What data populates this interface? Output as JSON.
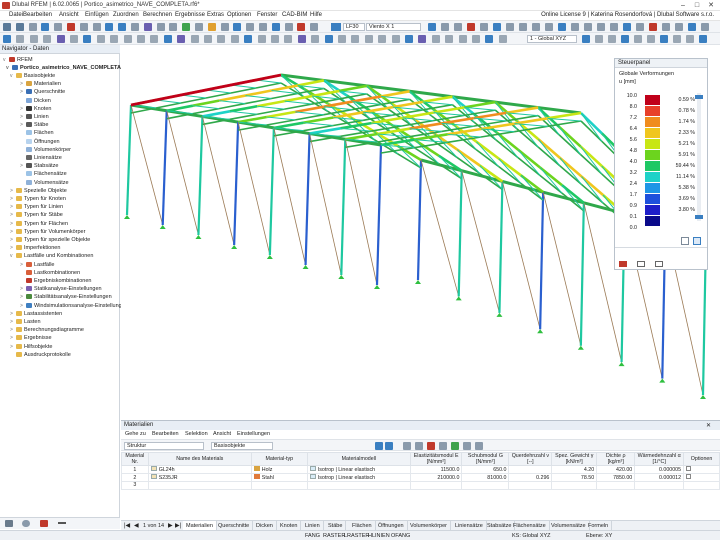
{
  "titlebar": {
    "title": "Dlubal RFEM | 6.02.0065 | Portico_asimetrico_NAVE_COMPLETA.rf6*"
  },
  "menu": {
    "items": [
      "Datei",
      "Bearbeiten",
      "Ansicht",
      "Einfügen",
      "Zuordnen",
      "Berechnen",
      "Ergebnisse",
      "Extras",
      "Optionen",
      "Fenster",
      "CAD-BIM",
      "Hilfe"
    ],
    "license": "Online License 9 | Katerina Rosendorfová | Dlubal Software s.r.o."
  },
  "toolbar": {
    "load_case": "LF30",
    "load_name": "Viento X 1",
    "coord_system": "1 - Global XYZ"
  },
  "navigator": {
    "title": "Navigator - Daten",
    "root": "RFEM",
    "project": "Portico_asimetrico_NAVE_COMPLETA.rf6*",
    "items": [
      {
        "label": "Basisobjekte",
        "level": 1,
        "exp": "v",
        "icon": "#e6b94a"
      },
      {
        "label": "Materialien",
        "level": 2,
        "exp": ">",
        "icon": "#d9a441"
      },
      {
        "label": "Querschnitte",
        "level": 2,
        "exp": ">",
        "icon": "#3a6fb5"
      },
      {
        "label": "Dicken",
        "level": 2,
        "exp": "",
        "icon": "#7ea6d8"
      },
      {
        "label": "Knoten",
        "level": 2,
        "exp": ">",
        "icon": "#333333"
      },
      {
        "label": "Linien",
        "level": 2,
        "exp": ">",
        "icon": "#555555"
      },
      {
        "label": "Stäbe",
        "level": 2,
        "exp": ">",
        "icon": "#5a5a5a"
      },
      {
        "label": "Flächen",
        "level": 2,
        "exp": "",
        "icon": "#9cc3e6"
      },
      {
        "label": "Öffnungen",
        "level": 2,
        "exp": "",
        "icon": "#b7d3ee"
      },
      {
        "label": "Volumenkörper",
        "level": 2,
        "exp": "",
        "icon": "#8fb1d8"
      },
      {
        "label": "Liniensätze",
        "level": 2,
        "exp": "",
        "icon": "#666666"
      },
      {
        "label": "Stabsätze",
        "level": 2,
        "exp": ">",
        "icon": "#555555"
      },
      {
        "label": "Flächensätze",
        "level": 2,
        "exp": "",
        "icon": "#9cc3e6"
      },
      {
        "label": "Volumensätze",
        "level": 2,
        "exp": "",
        "icon": "#8fb1d8"
      },
      {
        "label": "Spezielle Objekte",
        "level": 1,
        "exp": ">",
        "icon": "#e6b94a"
      },
      {
        "label": "Typen für Knoten",
        "level": 1,
        "exp": ">",
        "icon": "#e6b94a"
      },
      {
        "label": "Typen für Linien",
        "level": 1,
        "exp": ">",
        "icon": "#e6b94a"
      },
      {
        "label": "Typen für Stäbe",
        "level": 1,
        "exp": ">",
        "icon": "#e6b94a"
      },
      {
        "label": "Typen für Flächen",
        "level": 1,
        "exp": ">",
        "icon": "#e6b94a"
      },
      {
        "label": "Typen für Volumenkörper",
        "level": 1,
        "exp": ">",
        "icon": "#e6b94a"
      },
      {
        "label": "Typen für spezielle Objekte",
        "level": 1,
        "exp": ">",
        "icon": "#e6b94a"
      },
      {
        "label": "Imperfektionen",
        "level": 1,
        "exp": ">",
        "icon": "#e6b94a"
      },
      {
        "label": "Lastfälle und Kombinationen",
        "level": 1,
        "exp": "v",
        "icon": "#e6b94a"
      },
      {
        "label": "Lastfälle",
        "level": 2,
        "exp": ">",
        "icon": "#d95f3b"
      },
      {
        "label": "Lastkombinationen",
        "level": 2,
        "exp": "",
        "icon": "#d95f3b"
      },
      {
        "label": "Ergebniskombinationen",
        "level": 2,
        "exp": "",
        "icon": "#c0392b"
      },
      {
        "label": "Statikanalyse-Einstellungen",
        "level": 2,
        "exp": ">",
        "icon": "#7a5fb0"
      },
      {
        "label": "Stabilitätsanalyse-Einstellungen",
        "level": 2,
        "exp": ">",
        "icon": "#4b8a3e"
      },
      {
        "label": "Windsimulationsanalyse-Einstellungen",
        "level": 2,
        "exp": ">",
        "icon": "#3f7fc1"
      },
      {
        "label": "Lastassistenten",
        "level": 1,
        "exp": ">",
        "icon": "#e6b94a"
      },
      {
        "label": "Lasten",
        "level": 1,
        "exp": ">",
        "icon": "#e6b94a"
      },
      {
        "label": "Berechnungsdiagramme",
        "level": 1,
        "exp": ">",
        "icon": "#e6b94a"
      },
      {
        "label": "Ergebnisse",
        "level": 1,
        "exp": ">",
        "icon": "#e6b94a"
      },
      {
        "label": "Hilfsobjekte",
        "level": 1,
        "exp": ">",
        "icon": "#e6b94a"
      },
      {
        "label": "Ausdruckprotokolle",
        "level": 1,
        "exp": "",
        "icon": "#e6b94a"
      }
    ]
  },
  "control_panel": {
    "title": "Steuerpanel",
    "subtitle": "Globale Verformungen",
    "unit": "u [mm]",
    "values": [
      "10.0",
      "8.0",
      "7.2",
      "6.4",
      "5.6",
      "4.8",
      "4.0",
      "3.2",
      "2.4",
      "1.7",
      "0.9",
      "0.1",
      "0.0"
    ],
    "colors": [
      "#c0001a",
      "#e8402a",
      "#f08c1e",
      "#f0c61e",
      "#c8e614",
      "#6cd41e",
      "#1ec864",
      "#1ed2c8",
      "#1e96e6",
      "#1e50dc",
      "#1e1ec8",
      "#0a0a8a"
    ],
    "percents": [
      "0.59 %",
      "0.78 %",
      "1.74 %",
      "2.33 %",
      "5.21 %",
      "5.91 %",
      "59.44 %",
      "11.14 %",
      "5.38 %",
      "3.69 %",
      "3.80 %"
    ]
  },
  "materials": {
    "title": "Materialien",
    "menu": [
      "Gehe zu",
      "Bearbeiten",
      "Selektion",
      "Ansicht",
      "Einstellungen"
    ],
    "filter1": "Struktur",
    "filter2": "Basisobjekte",
    "headers": [
      "Material Nr.",
      "Name des Materials",
      "Material-typ",
      "Materialmodell",
      "Elastizitätsmodul E [N/mm²]",
      "Schubmodul G [N/mm²]",
      "Querdehnzahl ν [--]",
      "Spez. Gewicht γ [kN/m³]",
      "Dichte ρ [kg/m³]",
      "Wärmedehnzahl α [1/°C]",
      "Optionen"
    ],
    "rows": [
      {
        "no": "1",
        "name": "GL24h",
        "type": "Holz",
        "type_color": "#d9a441",
        "model": "Isotrop | Linear elastisch",
        "e": "11500.0",
        "g": "650.0",
        "nu": "",
        "gamma": "4.20",
        "rho": "420.00",
        "alpha": "0.000005"
      },
      {
        "no": "2",
        "name": "S235JR",
        "type": "Stahl",
        "type_color": "#e07a3a",
        "model": "Isotrop | Linear elastisch",
        "e": "210000.0",
        "g": "81000.0",
        "nu": "0.296",
        "gamma": "78.50",
        "rho": "7850.00",
        "alpha": "0.000012"
      },
      {
        "no": "3",
        "name": "",
        "type": "",
        "type_color": "",
        "model": "",
        "e": "",
        "g": "",
        "nu": "",
        "gamma": "",
        "rho": "",
        "alpha": ""
      }
    ]
  },
  "tabs": {
    "pager": "1 von 14",
    "items": [
      "Materialien",
      "Querschnitte",
      "Dicken",
      "Knoten",
      "Linien",
      "Stäbe",
      "Flächen",
      "Öffnungen",
      "Volumenkörper",
      "Liniensätze",
      "Stabsätze",
      "Flächensätze",
      "Volumensätze",
      "Formeln"
    ]
  },
  "status": {
    "snaps": [
      "FANG",
      "RASTER",
      "LRASTER",
      "HLINIEN",
      "OFANG"
    ],
    "ks": "KS: Global XYZ",
    "plane": "Ebene: XY"
  }
}
